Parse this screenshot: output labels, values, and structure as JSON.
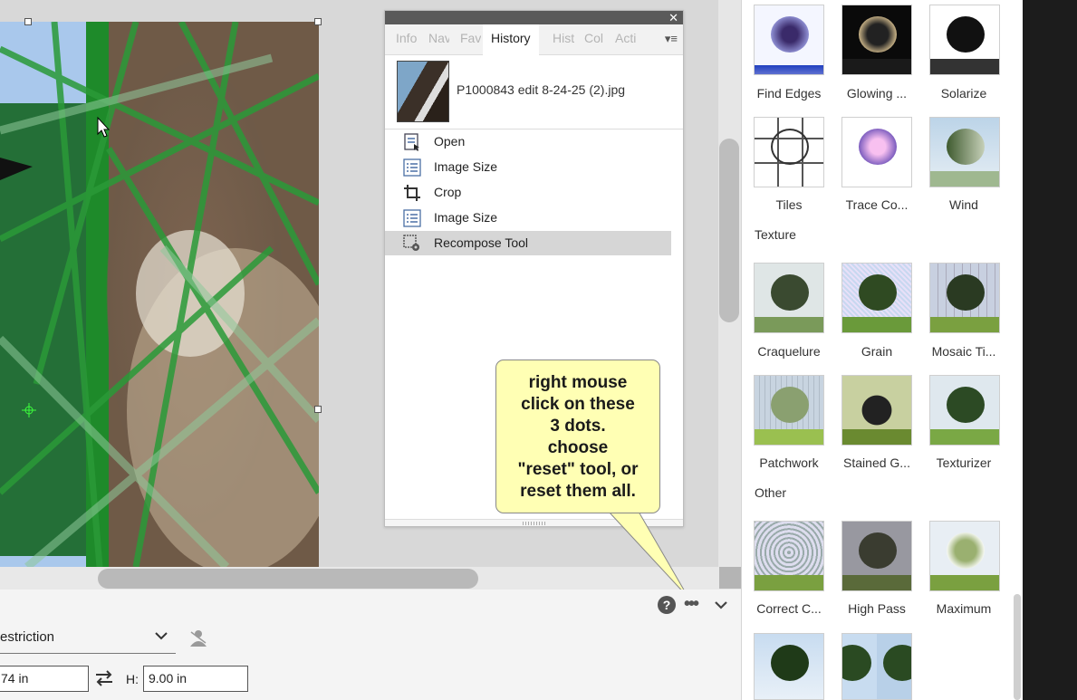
{
  "history_panel": {
    "tabs": [
      "Info",
      "Nav",
      "Fav",
      "History",
      "Hist",
      "Col",
      "Acti"
    ],
    "active_tab": "History",
    "document_name": "P1000843 edit 8-24-25 (2).jpg",
    "items": [
      {
        "label": "Open",
        "icon": "open-document-icon"
      },
      {
        "label": "Image Size",
        "icon": "image-size-icon"
      },
      {
        "label": "Crop",
        "icon": "crop-icon"
      },
      {
        "label": "Image Size",
        "icon": "image-size-icon"
      },
      {
        "label": "Recompose Tool",
        "icon": "recompose-tool-icon",
        "selected": true
      }
    ]
  },
  "callout": {
    "lines": [
      "right mouse",
      "click on these",
      "3 dots.",
      "choose",
      "\"reset\" tool, or",
      "reset them all."
    ]
  },
  "options_bar": {
    "restriction_label": "estriction",
    "width_value": "74 in",
    "height_label": "H:",
    "height_value": "9.00 in"
  },
  "effects": {
    "row1": [
      "Find Edges",
      "Glowing ...",
      "Solarize"
    ],
    "row2": [
      "Tiles",
      "Trace Co...",
      "Wind"
    ],
    "category_texture": "Texture",
    "row3": [
      "Craquelure",
      "Grain",
      "Mosaic Ti..."
    ],
    "row4": [
      "Patchwork",
      "Stained G...",
      "Texturizer"
    ],
    "category_other": "Other",
    "row5": [
      "Correct C...",
      "High Pass",
      "Maximum"
    ]
  },
  "colors": {
    "accent_green": "#1e8a2a",
    "callout_fill": "#ffffb4",
    "panel_titlebar": "#5a5a5a"
  }
}
